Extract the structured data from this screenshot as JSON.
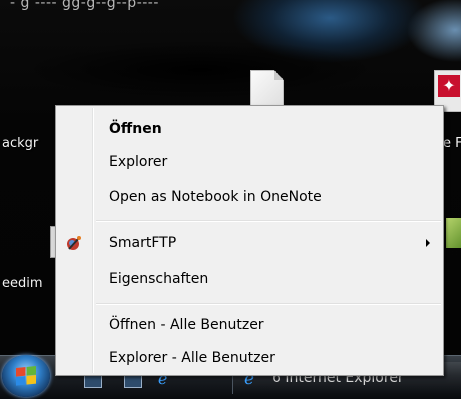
{
  "desktop": {
    "top_text": "‑ g ‑‑‑‑ gg‑g‑‑g‑‑p‑‑‑‑",
    "labels": {
      "left_upper": "ackgr",
      "right_upper": "e F",
      "left_lower": "eedim"
    }
  },
  "context_menu": {
    "items": [
      {
        "label": "Öffnen",
        "bold": true
      },
      {
        "label": "Explorer"
      },
      {
        "label": "Open as Notebook in OneNote"
      },
      {
        "label": "SmartFTP",
        "icon": "smartftp-icon",
        "has_submenu": true
      },
      {
        "label": "Eigenschaften"
      },
      {
        "label": "Öffnen - Alle Benutzer"
      },
      {
        "label": "Explorer - Alle Benutzer"
      }
    ]
  },
  "taskbar": {
    "start_button": "windows-start-orb",
    "task_label": "6 Internet Explorer"
  },
  "colors": {
    "menu_bg": "#f0f0f0",
    "menu_border": "#979797",
    "taskbar": "#1b1f24"
  }
}
